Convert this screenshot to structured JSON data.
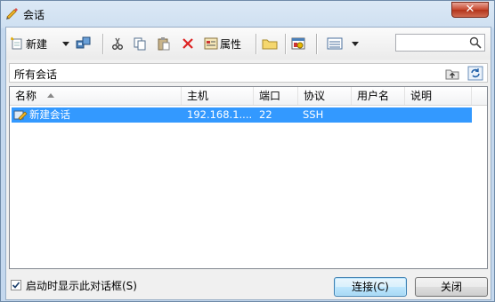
{
  "window": {
    "title": "会话",
    "close_glyph": "✕"
  },
  "toolbar": {
    "new_label": "新建",
    "properties_label": "属性",
    "search_placeholder": ""
  },
  "path": {
    "text": "所有会话"
  },
  "list": {
    "columns": [
      "名称",
      "主机",
      "端口",
      "协议",
      "用户名",
      "说明"
    ],
    "rows": [
      {
        "name": "新建会话",
        "host": "192.168.1....",
        "port": "22",
        "protocol": "SSH",
        "user": "",
        "desc": ""
      }
    ]
  },
  "footer": {
    "startup_checkbox_label": "启动时显示此对话框(S)",
    "startup_checked": true,
    "connect_label": "连接(C)",
    "close_label": "关闭"
  },
  "colors": {
    "selection": "#3399ff",
    "accent": "#3c7fb1"
  }
}
